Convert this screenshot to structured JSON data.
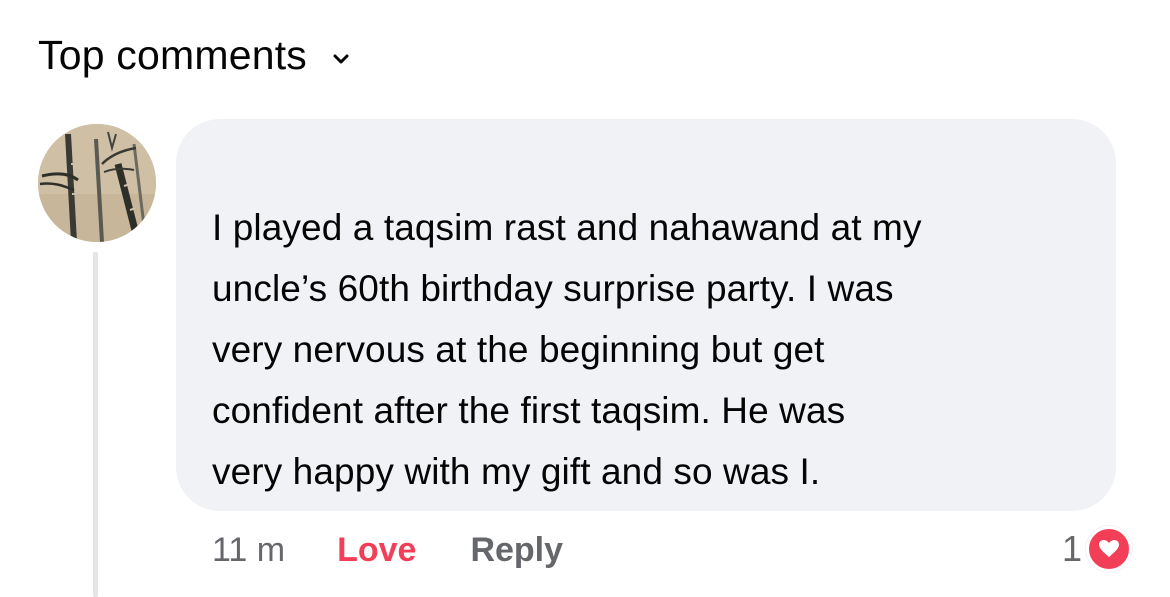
{
  "section": {
    "sort_label": "Top comments",
    "sort_icon": "chevron-down-icon"
  },
  "comment": {
    "avatar_icon": "bamboo-painting-avatar",
    "text": "I played a taqsim rast and nahawand at my\nuncle’s 60th birthday surprise party. I was\nvery nervous at the beginning but get\nconfident after the first taqsim. He was\nvery happy with my gift and so was I.",
    "timestamp": "11 m",
    "love_label": "Love",
    "reply_label": "Reply",
    "reaction_count": "1",
    "reaction_icon": "heart-icon"
  },
  "colors": {
    "bubble_bg": "#f0f2f5",
    "love": "#f33e58",
    "secondary_text": "#65676b",
    "primary_text": "#050505"
  }
}
